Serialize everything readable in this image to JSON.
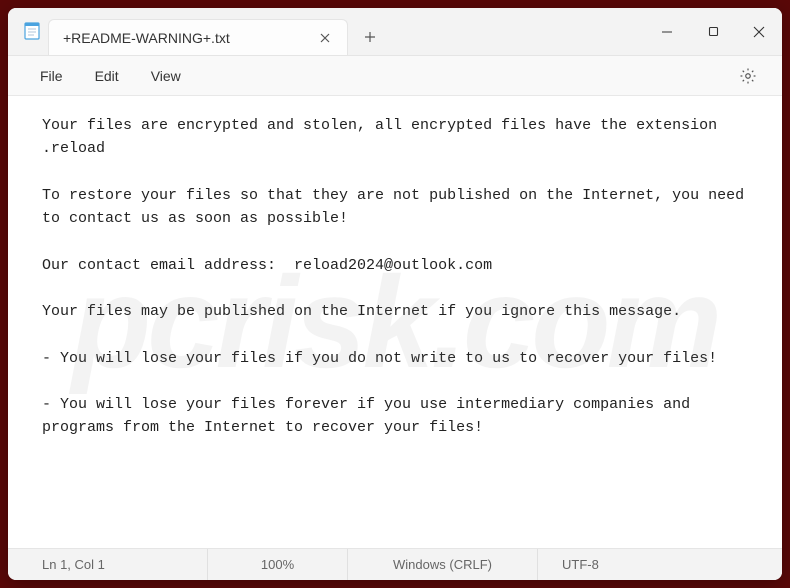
{
  "window": {
    "tab_title": "+README-WARNING+.txt"
  },
  "menu": {
    "file": "File",
    "edit": "Edit",
    "view": "View"
  },
  "content": {
    "text": "Your files are encrypted and stolen, all encrypted files have the extension .reload\n\nTo restore your files so that they are not published on the Internet, you need to contact us as soon as possible!\n\nOur contact email address:  reload2024@outlook.com\n\nYour files may be published on the Internet if you ignore this message.\n\n- You will lose your files if you do not write to us to recover your files!\n\n- You will lose your files forever if you use intermediary companies and programs from the Internet to recover your files!"
  },
  "status": {
    "position": "Ln 1, Col 1",
    "zoom": "100%",
    "eol": "Windows (CRLF)",
    "encoding": "UTF-8"
  },
  "watermark": "pcrisk.com"
}
